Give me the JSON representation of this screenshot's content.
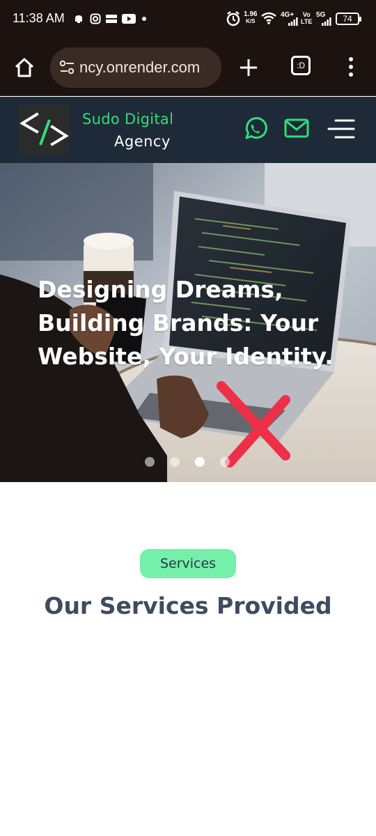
{
  "status_bar": {
    "time": "11:38 AM",
    "net_speed": "1.96",
    "net_speed_unit": "K/S",
    "net_4g": "4G+",
    "volte_top": "Vo",
    "volte_bottom": "LTE",
    "net_5g": "5G",
    "battery": "74",
    "icons": [
      "notification-icon",
      "instagram-icon",
      "temu-icon",
      "youtube-icon",
      "alarm-icon",
      "wifi-icon",
      "signal-icon"
    ]
  },
  "browser": {
    "url": "ncy.onrender.com",
    "tabs_label": ":D",
    "icons": [
      "home-icon",
      "tune-icon",
      "plus-icon",
      "tabs-icon",
      "kebab-menu-icon"
    ]
  },
  "site_header": {
    "brand_line1": "Sudo Digital",
    "brand_line2": "Agency",
    "accent_color": "#2ddf78",
    "background": "#1f2a38",
    "icons": [
      "code-logo-icon",
      "whatsapp-icon",
      "mail-icon",
      "hamburger-icon"
    ]
  },
  "hero": {
    "title": "Designing Dreams, Building Brands: Your Website, Your Identity.",
    "carousel_dots": 4,
    "active_dot": 3
  },
  "services": {
    "badge": "Services",
    "title": "Our Services Provided",
    "badge_color": "#74f0aa",
    "title_color": "#3f4b60"
  }
}
